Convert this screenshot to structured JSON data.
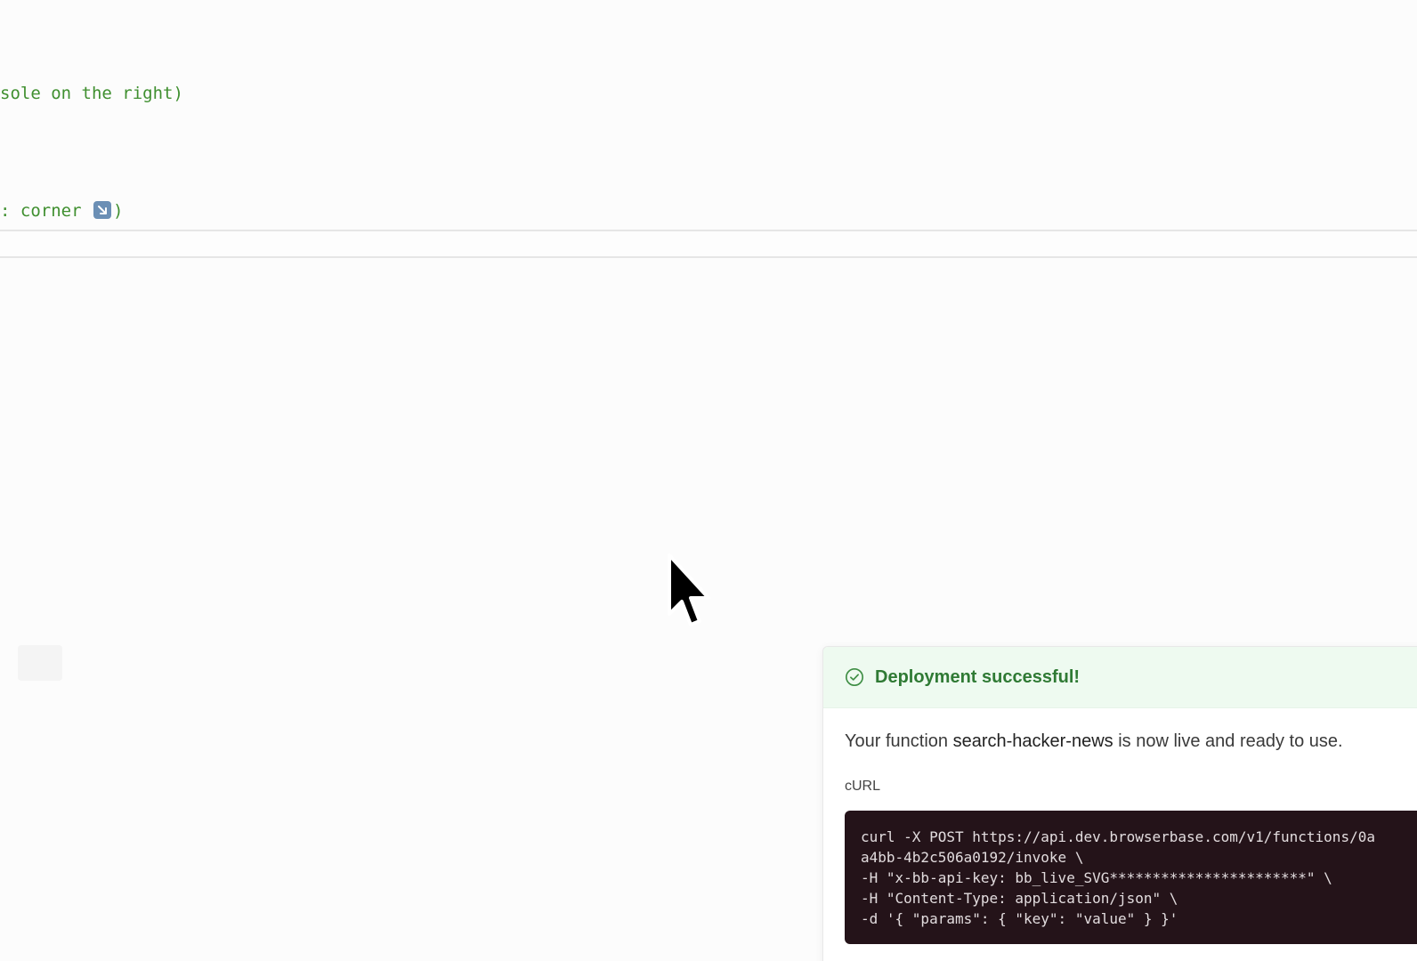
{
  "editor": {
    "lines": [
      "sole on the right)",
      ": corner ",
      ")"
    ]
  },
  "toast": {
    "title": "Deployment successful!",
    "message_prefix": "Your function ",
    "function_name": "search-hacker-news",
    "message_suffix": " is now live and ready to use.",
    "section_label": "cURL",
    "curl_lines": [
      "curl -X POST https://api.dev.browserbase.com/v1/functions/0a",
      "a4bb-4b2c506a0192/invoke \\",
      "-H \"x-bb-api-key: bb_live_SVG***********************\" \\",
      "-H \"Content-Type: application/json\" \\",
      "-d '{ \"params\": { \"key\": \"value\" } }'"
    ],
    "accent_color": "#2f7a34"
  },
  "icons": {
    "emoji": "arrow-down-right-icon",
    "status": "check-circle-icon",
    "cursor": "mouse-pointer-icon"
  }
}
